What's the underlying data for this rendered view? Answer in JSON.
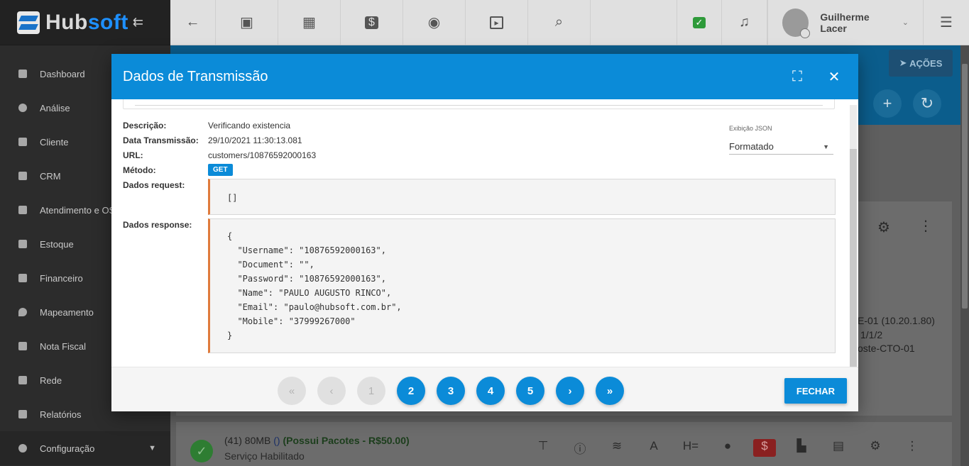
{
  "app": {
    "logo_hub": "Hub",
    "logo_soft": "soft"
  },
  "sidebar": {
    "items": [
      {
        "label": "Dashboard",
        "icon": "dashboard-icon"
      },
      {
        "label": "Análise",
        "icon": "pie-chart-icon"
      },
      {
        "label": "Cliente",
        "icon": "contact-card-icon"
      },
      {
        "label": "CRM",
        "icon": "board-icon"
      },
      {
        "label": "Atendimento e OS",
        "icon": "calendar-clock-icon"
      },
      {
        "label": "Estoque",
        "icon": "box-icon"
      },
      {
        "label": "Financeiro",
        "icon": "money-icon"
      },
      {
        "label": "Mapeamento",
        "icon": "map-pin-icon"
      },
      {
        "label": "Nota Fiscal",
        "icon": "document-icon"
      },
      {
        "label": "Rede",
        "icon": "server-icon"
      },
      {
        "label": "Relatórios",
        "icon": "report-icon"
      },
      {
        "label": "Configuração",
        "icon": "gear-icon"
      }
    ]
  },
  "topbar": {
    "user_name": "Guilherme Lacer",
    "icons": {
      "back": "←",
      "contact": "▣",
      "calendar": "▦",
      "dollar": "$",
      "eye": "◉",
      "terminal": "▸",
      "search": "⌕",
      "chat": "✓",
      "bell": "♫",
      "menu": "☰"
    }
  },
  "background": {
    "acoes_label": "AÇÕES",
    "equipment_lines": [
      "E-01 (10.20.1.80)",
      "1/1/2",
      "oste-CTO-01"
    ],
    "plan_label": "(41) 80MB",
    "plan_extra": "()",
    "plan_packages": "(Possui Pacotes - R$50.00)",
    "plan_status": "Serviço Habilitado"
  },
  "modal": {
    "title": "Dados de Transmissão",
    "fields": {
      "descricao_label": "Descrição:",
      "descricao_value": "Verificando existencia",
      "data_label": "Data Transmissão:",
      "data_value": "29/10/2021 11:30:13.081",
      "url_label": "URL:",
      "url_value": "customers/10876592000163",
      "metodo_label": "Método:",
      "metodo_value": "GET",
      "request_label": "Dados request:",
      "response_label": "Dados response:"
    },
    "json_view": {
      "label": "Exibição JSON",
      "selected": "Formatado"
    },
    "request_body": "[]",
    "response_body": "{\n  \"Username\": \"10876592000163\",\n  \"Document\": \"\",\n  \"Password\": \"10876592000163\",\n  \"Name\": \"PAULO AUGUSTO RINCO\",\n  \"Email\": \"paulo@hubsoft.com.br\",\n  \"Mobile\": \"37999267000\"\n}",
    "pagination": {
      "first": "«",
      "prev": "‹",
      "pages": [
        "1",
        "2",
        "3",
        "4",
        "5"
      ],
      "next": "›",
      "last": "»"
    },
    "close_button": "FECHAR"
  }
}
